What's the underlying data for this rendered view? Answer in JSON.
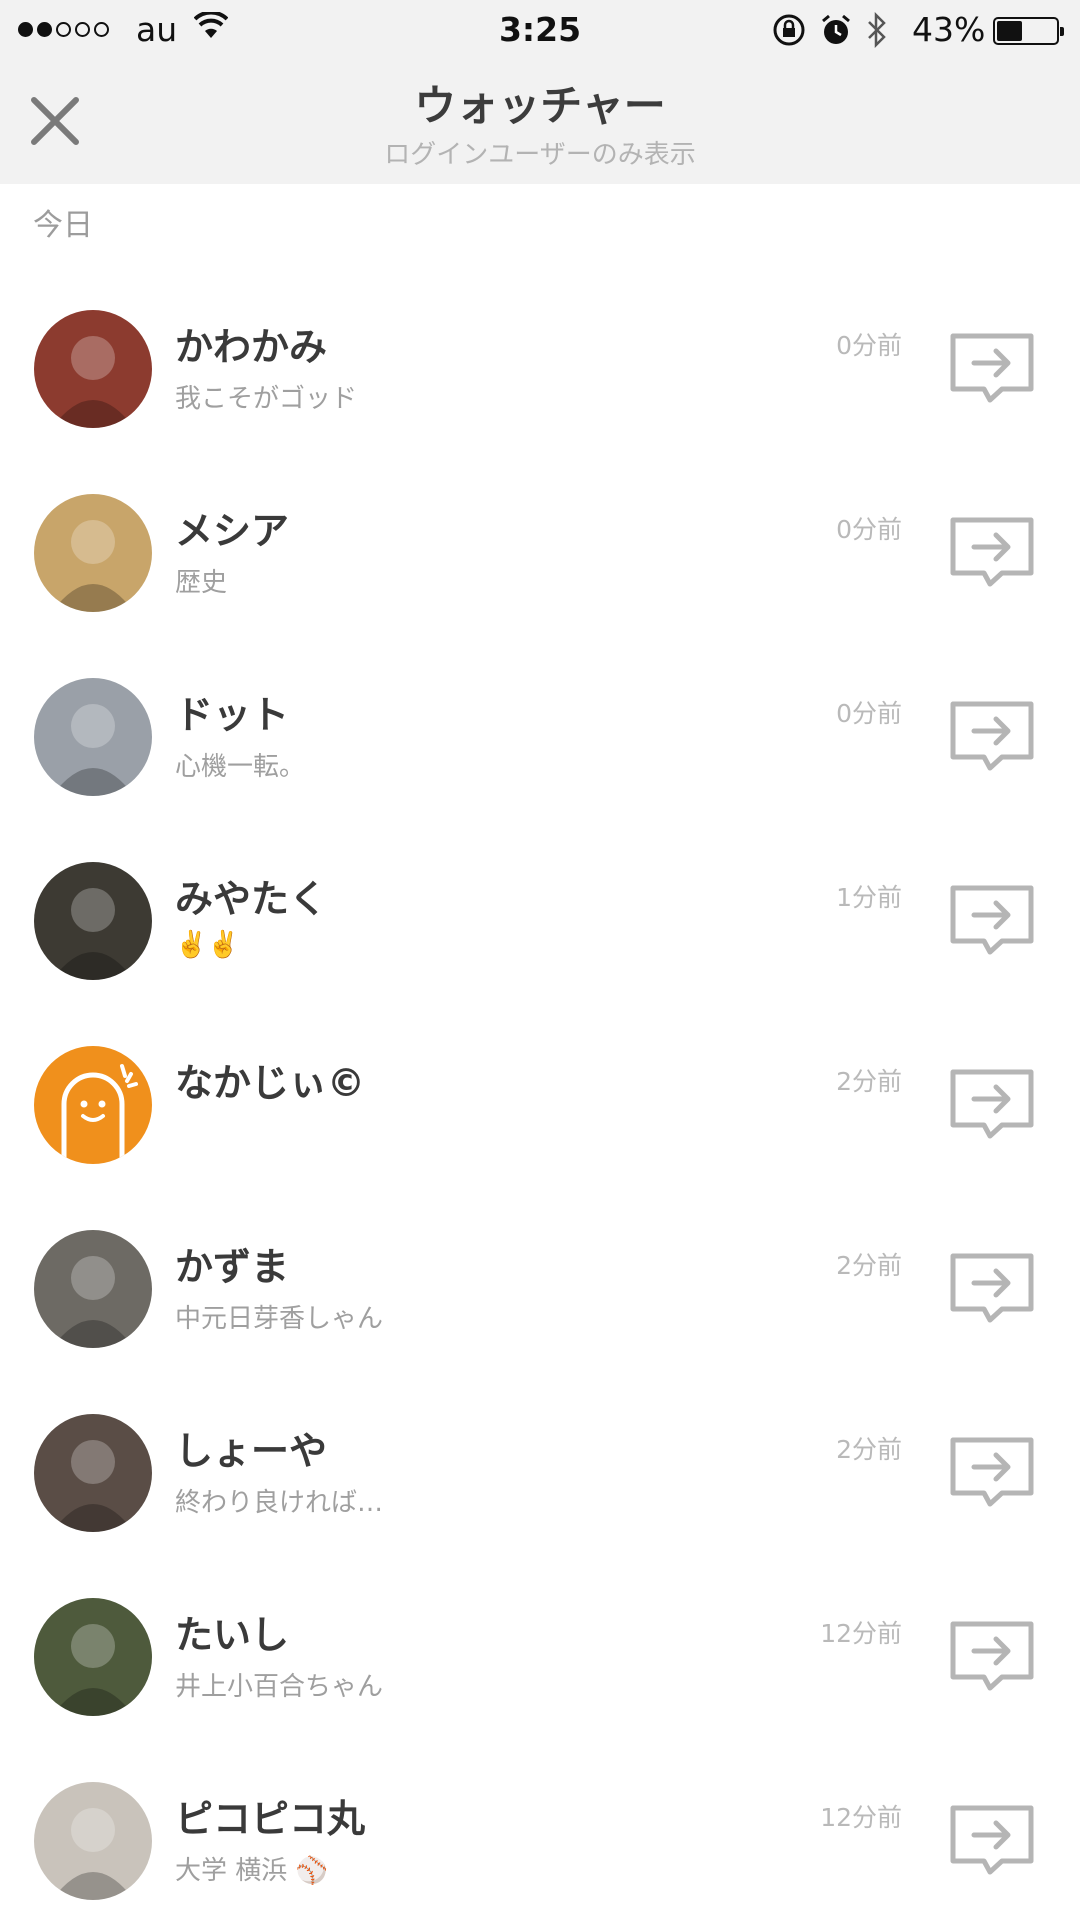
{
  "status": {
    "signal_bars": 5,
    "signal_filled": 2,
    "carrier": "au",
    "time": "3:25",
    "battery_pct": "43%",
    "battery_level": 0.43
  },
  "header": {
    "title": "ウォッチャー",
    "subtitle": "ログインユーザーのみ表示"
  },
  "section_label": "今日",
  "users": [
    {
      "name": "かわかみ",
      "bio": "我こそがゴッド",
      "time": "0分前",
      "avatar": "photo-person-blond",
      "avatar_bg": "#8c3b2f"
    },
    {
      "name": "メシア",
      "bio": "歴史",
      "time": "0分前",
      "avatar": "photo-ramen",
      "avatar_bg": "#c8a56a"
    },
    {
      "name": "ドット",
      "bio": "心機一転。",
      "time": "0分前",
      "avatar": "photo-person-street",
      "avatar_bg": "#9aa0a8"
    },
    {
      "name": "みやたく",
      "bio": "✌️✌️",
      "time": "1分前",
      "avatar": "photo-people-dark",
      "avatar_bg": "#3d3a33"
    },
    {
      "name": "なかじぃ©",
      "bio": "",
      "time": "2分前",
      "avatar": "default-avatar-orange",
      "avatar_bg": "#f0901c"
    },
    {
      "name": "かずま",
      "bio": "中元日芽香しゃん",
      "time": "2分前",
      "avatar": "photo-statue",
      "avatar_bg": "#6d6a64"
    },
    {
      "name": "しょーや",
      "bio": "終わり良ければ…",
      "time": "2分前",
      "avatar": "photo-group",
      "avatar_bg": "#5a4d46"
    },
    {
      "name": "たいし",
      "bio": "井上小百合ちゃん",
      "time": "12分前",
      "avatar": "photo-car-forest",
      "avatar_bg": "#4e5a3c"
    },
    {
      "name": "ピコピコ丸",
      "bio": "大学 横浜 ⚾",
      "time": "12分前",
      "avatar": "photo-two-people",
      "avatar_bg": "#c9c3bb"
    }
  ],
  "colors": {
    "header_bg": "#f2f2f2",
    "name_text": "#3a3a3a",
    "secondary_text": "#9f9f9f",
    "icon_gray": "#b5b5b5",
    "default_avatar": "#f0901c"
  },
  "icons": {
    "close": "close-icon",
    "share": "share-arrow-icon"
  }
}
